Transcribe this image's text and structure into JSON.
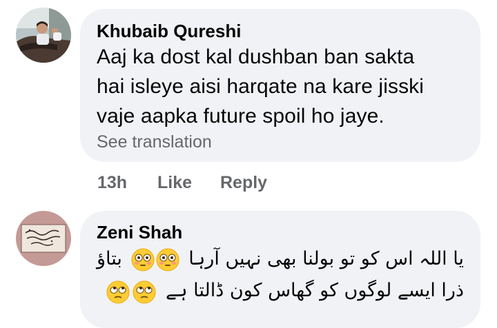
{
  "comments": [
    {
      "author": "Khubaib Qureshi",
      "lines": [
        "Aaj ka dost kal dushban ban sakta",
        "hai isleye aisi harqate na kare jisski",
        "vaje aapka future spoil ho jaye."
      ],
      "see_translation": "See translation",
      "time": "13h",
      "like_label": "Like",
      "reply_label": "Reply",
      "avatar_icon": "profile-photo-man-in-car"
    },
    {
      "author": "Zeni Shah",
      "lines": [
        "یا اللہ اس کو تو بولنا بھی نہیں آرہا",
        "بتاؤ",
        "ذرا ایسے لوگوں کو گھاس کون ڈالتا ہے"
      ],
      "emojis": [
        "flushed-face-icon",
        "flushed-face-icon",
        "face-with-rolling-eyes-icon",
        "face-with-rolling-eyes-icon"
      ],
      "avatar_icon": "profile-photo-calligraphy-card",
      "avatar_text": "یا مقلب القلوب ثبت قلبی علی دینک"
    }
  ],
  "colors": {
    "bubble_bg": "#f0f2f5",
    "text_primary": "#050505",
    "text_secondary": "#65676b"
  }
}
